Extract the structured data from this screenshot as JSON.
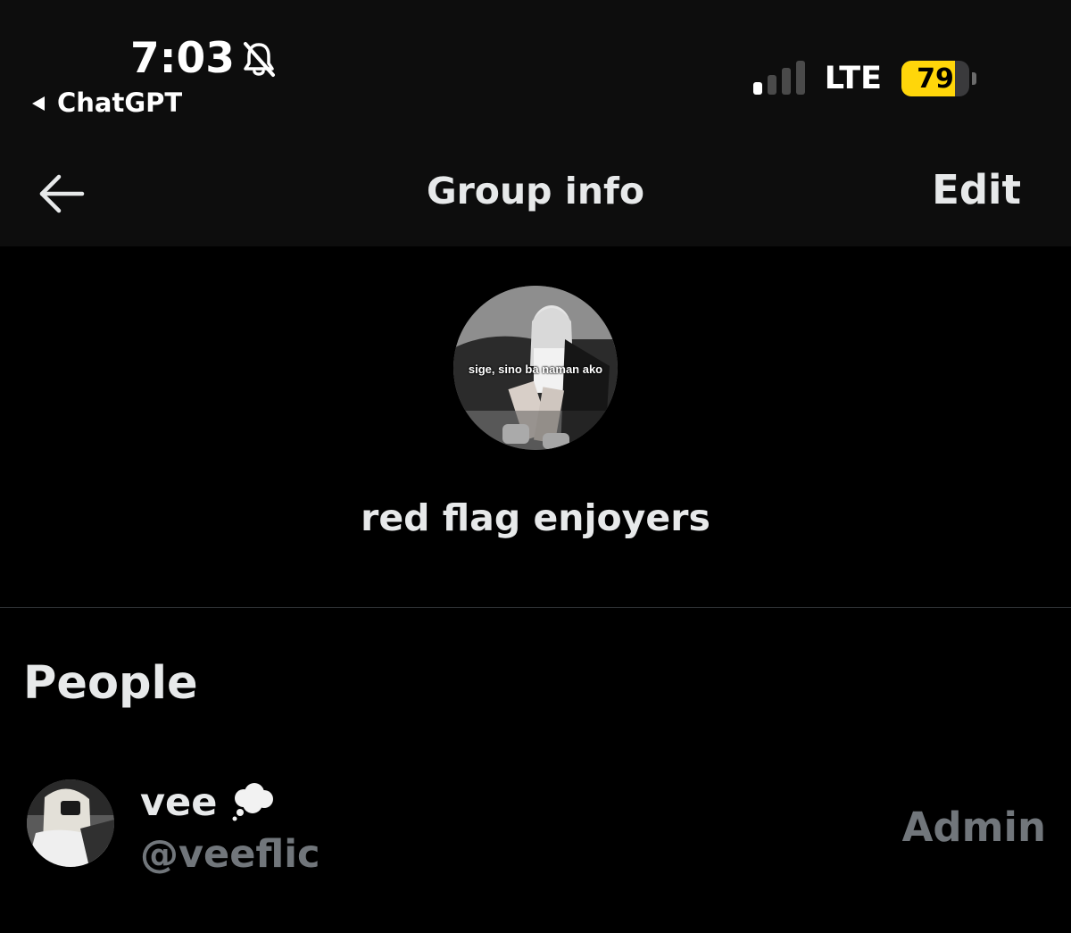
{
  "status_bar": {
    "time": "7:03",
    "back_app": "ChatGPT",
    "network": "LTE",
    "battery_percent": "79",
    "battery_level": 0.79,
    "signal_bars_active": 1,
    "icons": [
      "bell-slash-icon",
      "back-triangle-icon",
      "signal-icon",
      "battery-icon"
    ]
  },
  "nav": {
    "title": "Group info",
    "edit_label": "Edit",
    "back_icon": "arrow-left-icon"
  },
  "group": {
    "name": "red flag enjoyers",
    "avatar_caption": "sige, sino ba naman ako"
  },
  "people": {
    "section_title": "People",
    "members": [
      {
        "name": "vee",
        "emoji_icon": "thought-balloon-icon",
        "handle": "@veeflic",
        "role": "Admin"
      }
    ]
  },
  "colors": {
    "background": "#000000",
    "header_bg": "#0d0d0d",
    "primary_text": "#e7e9ea",
    "secondary_text": "#71767b",
    "divider": "#2f3336",
    "battery_accent": "#ffd60a"
  }
}
